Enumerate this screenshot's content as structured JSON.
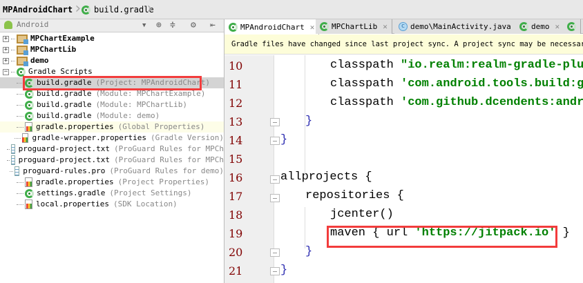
{
  "breadcrumb": {
    "project": "MPAndroidChart",
    "file": "build.gradle"
  },
  "toolbar": {
    "view_selector": "Android"
  },
  "tree": [
    {
      "name": "MPChartExample",
      "detail": "",
      "type": "folder"
    },
    {
      "name": "MPChartLib",
      "detail": "",
      "type": "folder"
    },
    {
      "name": "demo",
      "detail": "",
      "type": "folder"
    },
    {
      "name": "Gradle Scripts",
      "detail": "",
      "type": "gradle-group"
    },
    {
      "name": "build.gradle",
      "detail": "(Project: MPAndroidChart)",
      "type": "gradle"
    },
    {
      "name": "build.gradle",
      "detail": "(Module: MPChartExample)",
      "type": "gradle"
    },
    {
      "name": "build.gradle",
      "detail": "(Module: MPChartLib)",
      "type": "gradle"
    },
    {
      "name": "build.gradle",
      "detail": "(Module: demo)",
      "type": "gradle"
    },
    {
      "name": "gradle.properties",
      "detail": "(Global Properties)",
      "type": "prop"
    },
    {
      "name": "gradle-wrapper.properties",
      "detail": "(Gradle Version)",
      "type": "prop"
    },
    {
      "name": "proguard-project.txt",
      "detail": "(ProGuard Rules for MPCh",
      "type": "txt"
    },
    {
      "name": "proguard-project.txt",
      "detail": "(ProGuard Rules for MPCh",
      "type": "txt"
    },
    {
      "name": "proguard-rules.pro",
      "detail": "(ProGuard Rules for demo)",
      "type": "txt"
    },
    {
      "name": "gradle.properties",
      "detail": "(Project Properties)",
      "type": "prop"
    },
    {
      "name": "settings.gradle",
      "detail": "(Project Settings)",
      "type": "gradle"
    },
    {
      "name": "local.properties",
      "detail": "(SDK Location)",
      "type": "prop"
    }
  ],
  "tabs": [
    {
      "label": "MPAndroidChart",
      "icon": "gradle"
    },
    {
      "label": "MPChartLib",
      "icon": "gradle"
    },
    {
      "label": "demo\\MainActivity.java",
      "icon": "class"
    },
    {
      "label": "demo",
      "icon": "gradle"
    }
  ],
  "notice": "Gradle files have changed since last project sync. A project sync may be necessary fo",
  "code": [
    {
      "n": "10",
      "kw": "classpath ",
      "str": "\"io.realm:realm-gradle-plugi",
      "tail": ""
    },
    {
      "n": "11",
      "kw": "classpath ",
      "str": "'com.android.tools.build:gra",
      "tail": ""
    },
    {
      "n": "12",
      "kw": "classpath ",
      "str": "'com.github.dcendents:androi",
      "tail": ""
    },
    {
      "n": "13",
      "kw": "}",
      "str": "",
      "tail": ""
    },
    {
      "n": "14",
      "kw": "}",
      "str": "",
      "tail": ""
    },
    {
      "n": "15",
      "kw": "",
      "str": "",
      "tail": ""
    },
    {
      "n": "16",
      "kw": "allprojects {",
      "str": "",
      "tail": ""
    },
    {
      "n": "17",
      "kw": "repositories {",
      "str": "",
      "tail": ""
    },
    {
      "n": "18",
      "kw": "jcenter()",
      "str": "",
      "tail": ""
    },
    {
      "n": "19",
      "kw": "maven { url ",
      "str": "'https://jitpack.io'",
      "tail": " }"
    },
    {
      "n": "20",
      "kw": "}",
      "str": "",
      "tail": ""
    },
    {
      "n": "21",
      "kw": "}",
      "str": "",
      "tail": ""
    }
  ]
}
